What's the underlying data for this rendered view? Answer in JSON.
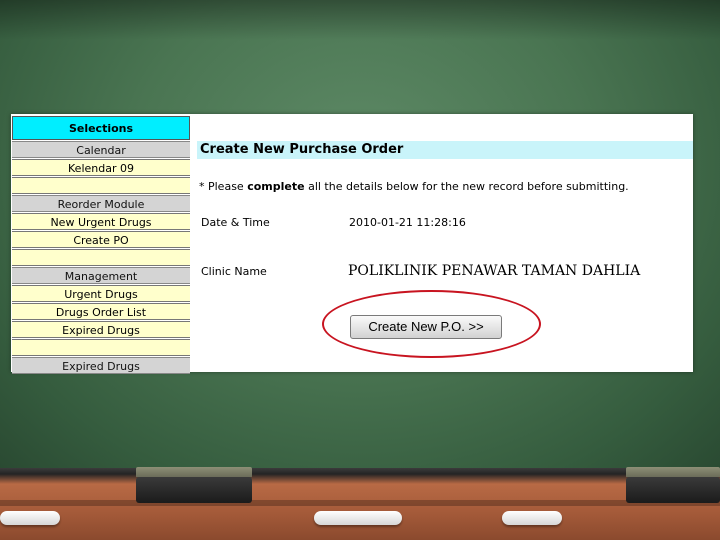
{
  "sidebar": {
    "title": "Selections",
    "items": [
      {
        "label": "Calendar",
        "kind": "head"
      },
      {
        "label": "Kelendar 09",
        "kind": "item"
      },
      {
        "label": "",
        "kind": "blank"
      },
      {
        "label": "Reorder Module",
        "kind": "head"
      },
      {
        "label": "New Urgent Drugs",
        "kind": "item"
      },
      {
        "label": "Create PO",
        "kind": "item"
      },
      {
        "label": "",
        "kind": "blank"
      },
      {
        "label": "Management",
        "kind": "head"
      },
      {
        "label": "Urgent Drugs",
        "kind": "item"
      },
      {
        "label": "Drugs Order List",
        "kind": "item"
      },
      {
        "label": "Expired Drugs",
        "kind": "item"
      },
      {
        "label": "",
        "kind": "blank"
      },
      {
        "label": "Expired Drugs",
        "kind": "head"
      }
    ]
  },
  "main": {
    "title": "Create New Purchase Order",
    "instruction_prefix": "* Please ",
    "instruction_bold": "complete",
    "instruction_suffix": " all the details below for the new record before submitting.",
    "datetime_label": "Date & Time",
    "datetime_value": "2010-01-21 11:28:16",
    "clinic_label": "Clinic Name",
    "clinic_value": "POLIKLINIK PENAWAR TAMAN DAHLIA",
    "submit_label": "Create New P.O. >>"
  },
  "colors": {
    "sidebar_title_bg": "#00eeff",
    "title_bar_bg": "#c9f4fa",
    "highlight_circle": "#c81420"
  }
}
